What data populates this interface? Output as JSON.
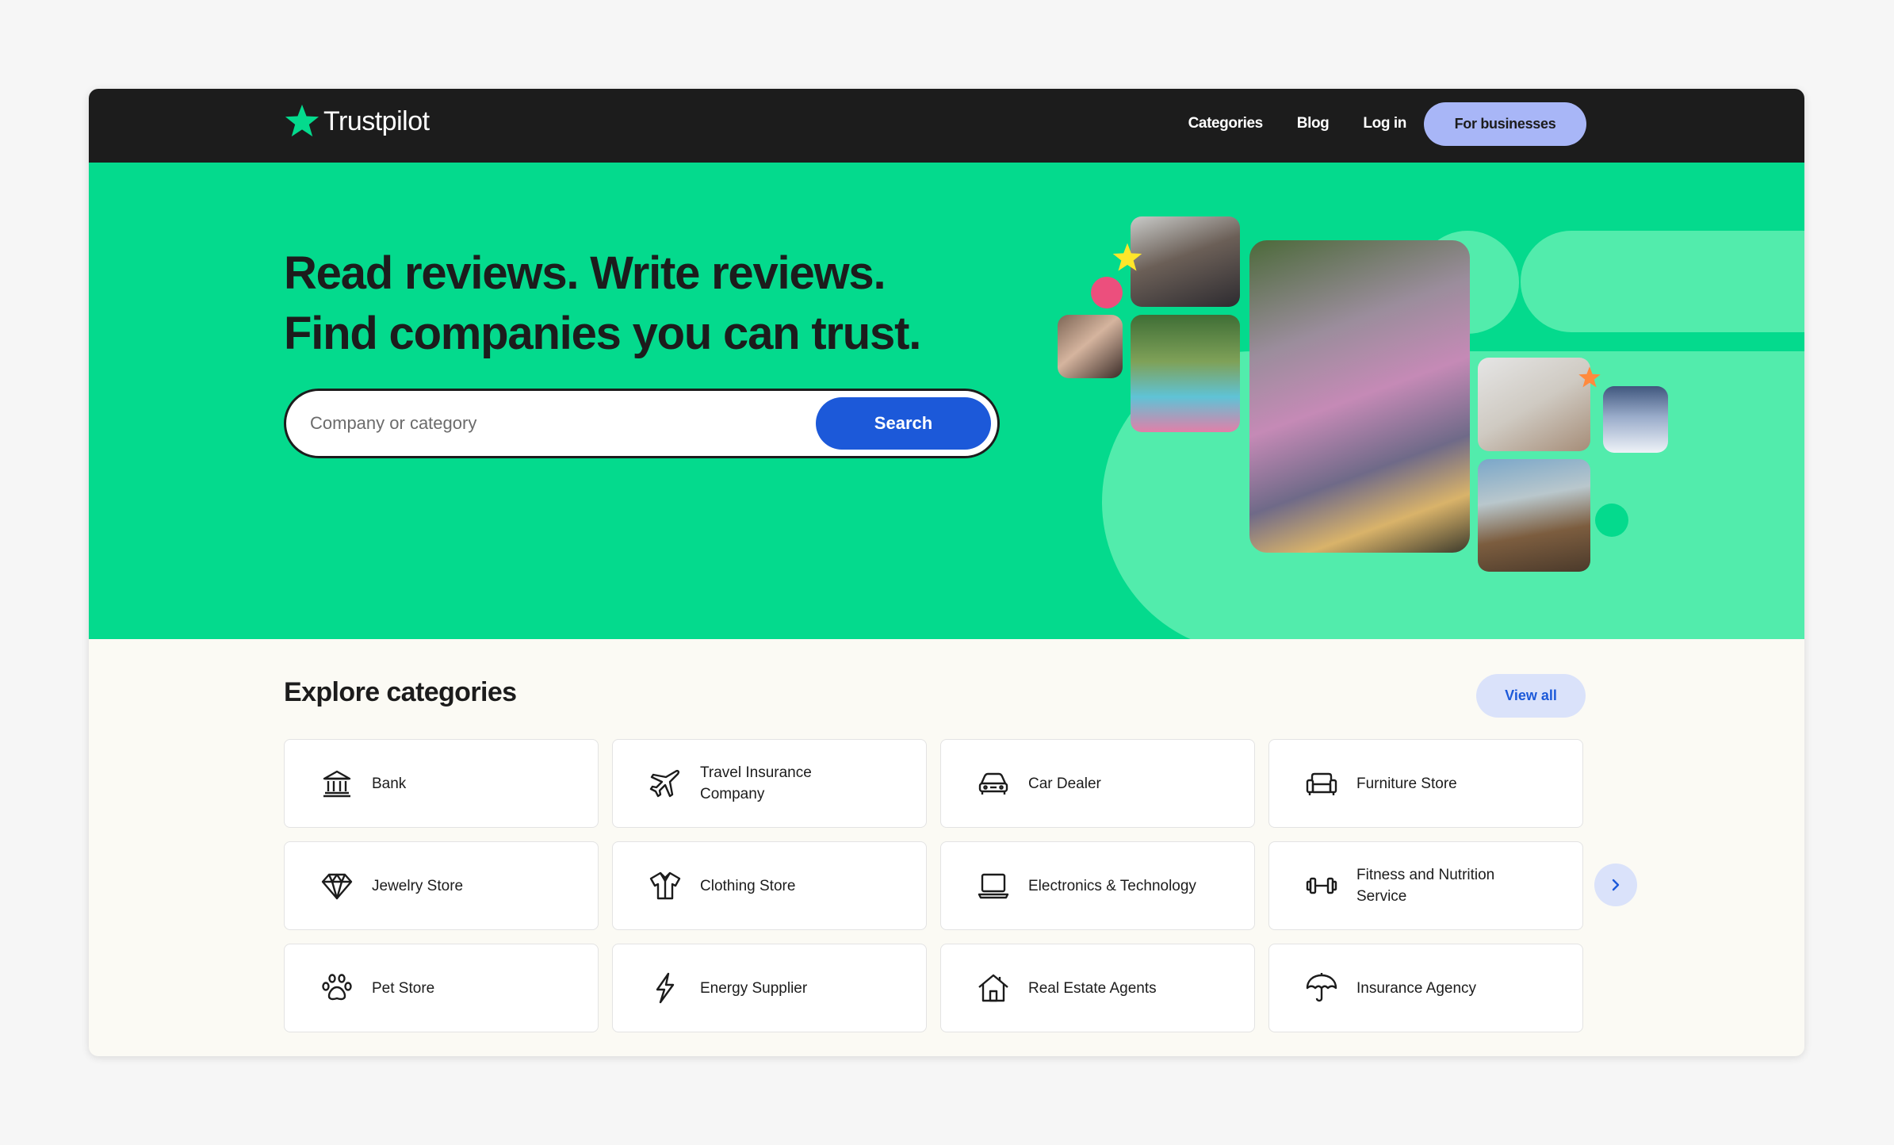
{
  "header": {
    "logo_text": "Trustpilot",
    "nav": [
      "Categories",
      "Blog",
      "Log in"
    ],
    "business_button": "For businesses"
  },
  "hero": {
    "title_line1": "Read reviews. Write reviews.",
    "title_line2": "Find companies you can trust.",
    "search_placeholder": "Company or category",
    "search_button": "Search"
  },
  "categories": {
    "title": "Explore categories",
    "view_all": "View all",
    "items": [
      {
        "label": "Bank",
        "icon": "bank-icon"
      },
      {
        "label": "Travel Insurance Company",
        "icon": "airplane-icon"
      },
      {
        "label": "Car Dealer",
        "icon": "car-icon"
      },
      {
        "label": "Furniture Store",
        "icon": "sofa-icon"
      },
      {
        "label": "Jewelry Store",
        "icon": "diamond-icon"
      },
      {
        "label": "Clothing Store",
        "icon": "shirt-icon"
      },
      {
        "label": "Electronics & Technology",
        "icon": "laptop-icon"
      },
      {
        "label": "Fitness and Nutrition Service",
        "icon": "dumbbell-icon"
      },
      {
        "label": "Pet Store",
        "icon": "paw-icon"
      },
      {
        "label": "Energy Supplier",
        "icon": "lightning-icon"
      },
      {
        "label": "Real Estate Agents",
        "icon": "house-icon"
      },
      {
        "label": "Insurance Agency",
        "icon": "umbrella-icon"
      }
    ]
  },
  "colors": {
    "brand_green": "#04da8d",
    "header_dark": "#1c1c1c",
    "search_blue": "#1c59d9",
    "business_button": "#a8b6f7"
  }
}
